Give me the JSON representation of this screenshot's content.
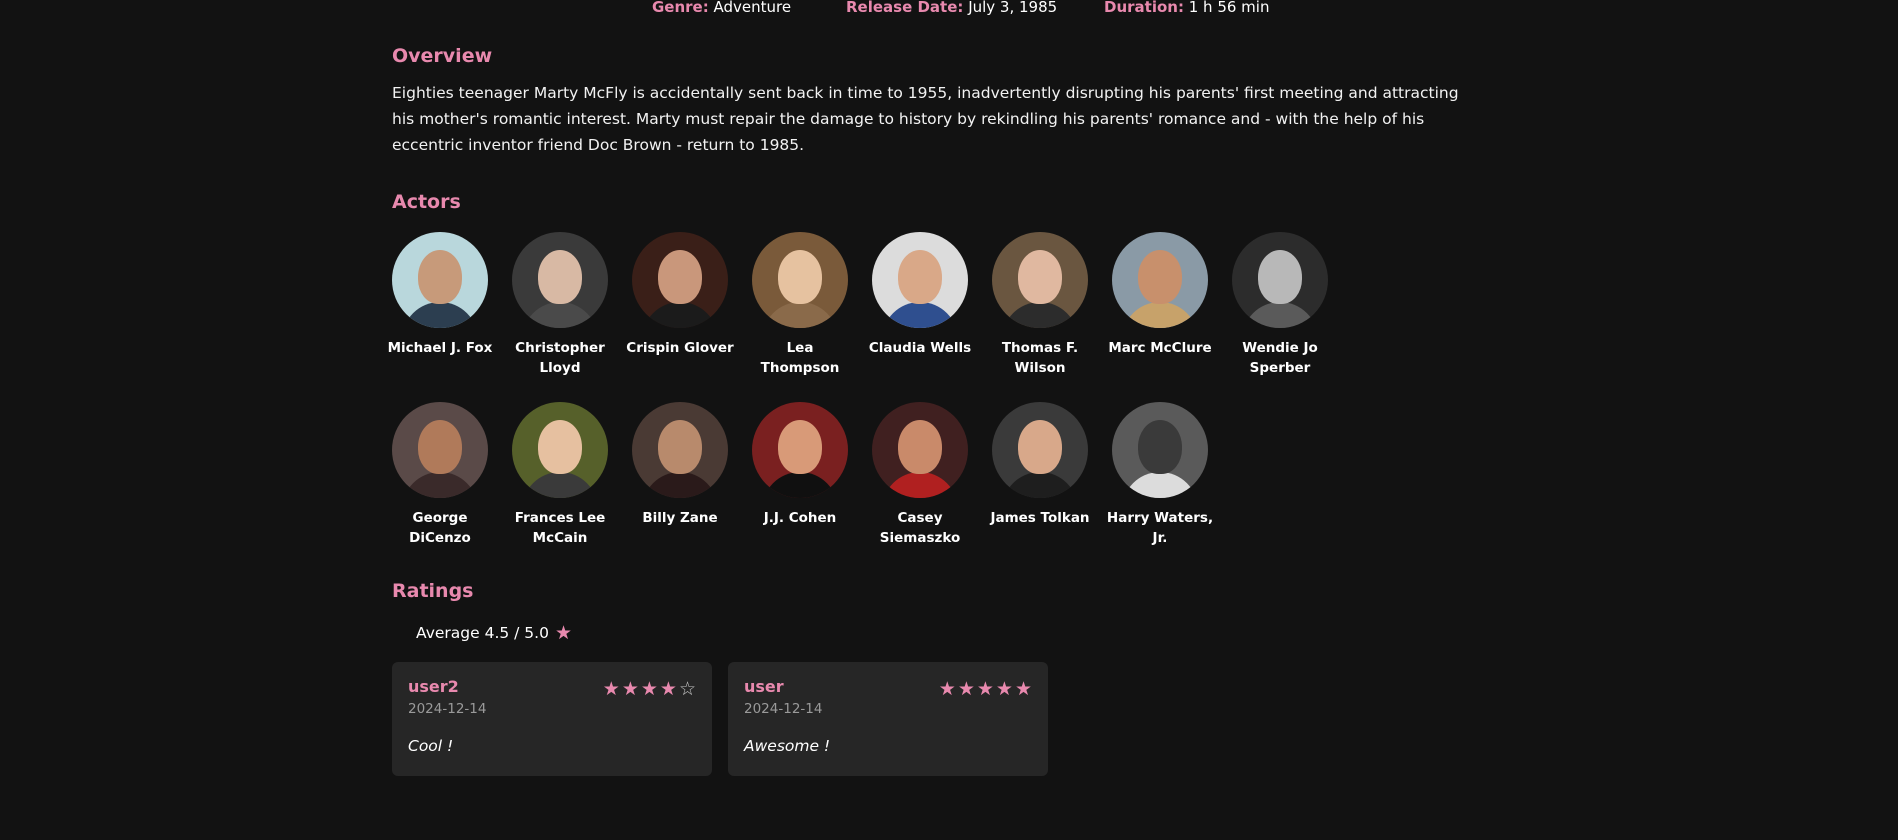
{
  "meta": {
    "genre_label": "Genre:",
    "genre_value": "Adventure",
    "release_label": "Release Date:",
    "release_value": "July 3, 1985",
    "duration_label": "Duration:",
    "duration_value": "1 h 56 min"
  },
  "overview": {
    "title": "Overview",
    "text": "Eighties teenager Marty McFly is accidentally sent back in time to 1955, inadvertently disrupting his parents' first meeting and attracting his mother's romantic interest. Marty must repair the damage to history by rekindling his parents' romance and - with the help of his eccentric inventor friend Doc Brown - return to 1985."
  },
  "actors": {
    "title": "Actors",
    "list": [
      {
        "name": "Michael J. Fox"
      },
      {
        "name": "Christopher Lloyd"
      },
      {
        "name": "Crispin Glover"
      },
      {
        "name": "Lea Thompson"
      },
      {
        "name": "Claudia Wells"
      },
      {
        "name": "Thomas F. Wilson"
      },
      {
        "name": "Marc McClure"
      },
      {
        "name": "Wendie Jo Sperber"
      },
      {
        "name": "George DiCenzo"
      },
      {
        "name": "Frances Lee McCain"
      },
      {
        "name": "Billy Zane"
      },
      {
        "name": "J.J. Cohen"
      },
      {
        "name": "Casey Siemaszko"
      },
      {
        "name": "James Tolkan"
      },
      {
        "name": "Harry Waters, Jr."
      }
    ]
  },
  "ratings": {
    "title": "Ratings",
    "average_text": "Average 4.5 / 5.0",
    "average_icon": "star-icon",
    "reviews": [
      {
        "user": "user2",
        "date": "2024-12-14",
        "comment": "Cool !",
        "stars": 4
      },
      {
        "user": "user",
        "date": "2024-12-14",
        "comment": "Awesome !",
        "stars": 5
      }
    ]
  },
  "colors": {
    "accent": "#e889ae",
    "background": "#121212",
    "card": "#262626",
    "muted": "#9a9a9a"
  }
}
